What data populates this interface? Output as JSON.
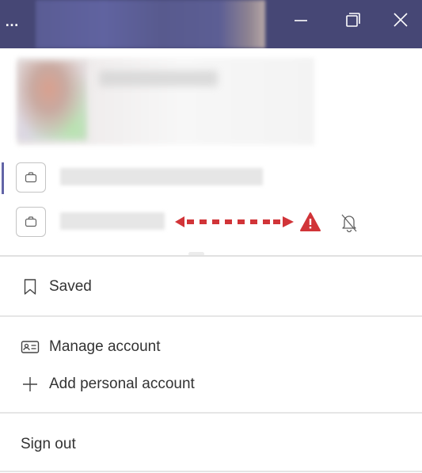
{
  "titlebar": {
    "more_label": "…",
    "bg_color": "#464775",
    "icons": [
      "more-icon",
      "minimize-icon",
      "restore-icon",
      "close-icon"
    ]
  },
  "profile": {
    "active_indicator_color": "#6264a7",
    "org_icon": "briefcase-icon",
    "warning_color": "#d13438",
    "arrow_color": "#d13438",
    "row_icons": [
      "warning-icon",
      "notifications-off-icon"
    ]
  },
  "menu": {
    "saved_label": "Saved",
    "manage_account_label": "Manage account",
    "add_personal_account_label": "Add personal account",
    "sign_out_label": "Sign out"
  }
}
